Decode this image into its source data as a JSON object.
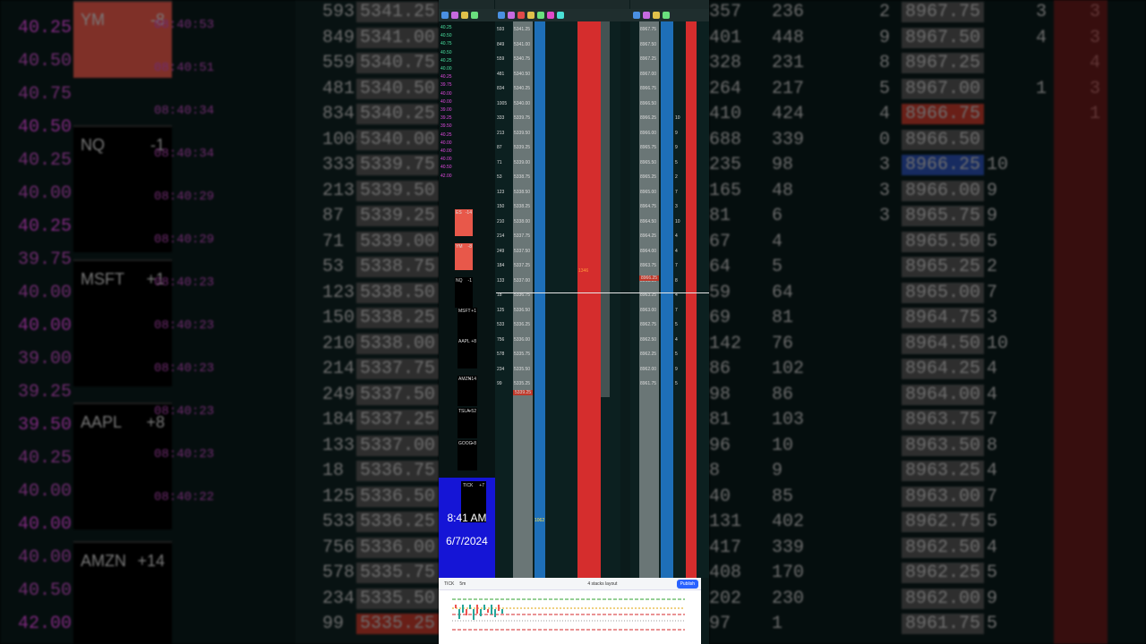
{
  "background_left": {
    "tiles": [
      {
        "symbol": "YM",
        "change": "-8"
      },
      {
        "symbol": "NQ",
        "change": "-1"
      },
      {
        "symbol": "MSFT",
        "change": "+1"
      },
      {
        "symbol": "AAPL",
        "change": "+8"
      },
      {
        "symbol": "AMZN",
        "change": "+14"
      }
    ],
    "ts_prices": [
      "40.25",
      "40.50",
      "40.75",
      "40.50",
      "40.25",
      "40.00",
      "40.25",
      "39.75",
      "40.00",
      "40.00",
      "39.00",
      "39.25",
      "39.50",
      "40.25",
      "40.00",
      "40.00",
      "40.00",
      "40.50",
      "42.00"
    ],
    "ts_times": [
      "08:40:53",
      "08:40:51",
      "08:40:34",
      "08:40:34",
      "08:40:29",
      "08:40:29",
      "08:40:23",
      "08:40:23",
      "08:40:23",
      "08:40:23",
      "08:40:23",
      "08:40:22"
    ],
    "dom_qty": [
      "593",
      "849",
      "559",
      "481",
      "834",
      "1005",
      "333",
      "213",
      "87",
      "71",
      "53",
      "123",
      "150",
      "210",
      "214",
      "249",
      "184",
      "133",
      "18",
      "125",
      "533",
      "756",
      "578",
      "234",
      "99"
    ],
    "dom_price": [
      "5341.25",
      "5341.00",
      "5340.75",
      "5340.50",
      "5340.25",
      "5340.00",
      "5339.75",
      "5339.50",
      "5339.25",
      "5339.00",
      "5338.75",
      "5338.50",
      "5338.25",
      "5338.00",
      "5337.75",
      "5337.50",
      "5337.25",
      "5337.00",
      "5336.75",
      "5336.50",
      "5336.25",
      "5336.00",
      "5335.75",
      "5335.50",
      "5335.25"
    ]
  },
  "background_right": {
    "qty": [
      "357",
      "401",
      "328",
      "264",
      "410",
      "688",
      "235",
      "165",
      "81",
      "67",
      "64",
      "59",
      "69",
      "142",
      "86",
      "98",
      "81",
      "96",
      "8",
      "40",
      "131",
      "417",
      "408",
      "202",
      "97"
    ],
    "vol": [
      "236",
      "448",
      "231",
      "217",
      "424",
      "339",
      "98",
      "48",
      "6",
      "4",
      "5",
      "64",
      "81",
      "76",
      "102",
      "86",
      "103",
      "10",
      "9",
      "85",
      "402",
      "339",
      "170",
      "230",
      "1"
    ],
    "side": [
      "2",
      "9",
      "8",
      "5",
      "4",
      "0",
      "3",
      "3",
      "3",
      "",
      "",
      "",
      "",
      "",
      "",
      "",
      "",
      "",
      "",
      "",
      "",
      "",
      "",
      "",
      ""
    ],
    "price": [
      "8967.75",
      "8967.50",
      "8967.25",
      "8967.00",
      "8966.75",
      "8966.50",
      "8966.25",
      "8966.00",
      "8965.75",
      "8965.50",
      "8965.25",
      "8965.00",
      "8964.75",
      "8964.50",
      "8964.25",
      "8964.00",
      "8963.75",
      "8963.50",
      "8963.25",
      "8963.00",
      "8962.75",
      "8962.50",
      "8962.25",
      "8962.00",
      "8961.75"
    ],
    "bid": [
      "",
      "",
      "",
      "",
      "",
      "",
      "10",
      "9",
      "9",
      "5",
      "2",
      "7",
      "3",
      "10",
      "4",
      "4",
      "7",
      "8",
      "4",
      "7",
      "5",
      "4",
      "5",
      "9",
      "5"
    ],
    "ask": [
      "3",
      "4",
      "",
      "1",
      "",
      "",
      "",
      "",
      "",
      "",
      "",
      "",
      "",
      "",
      "",
      "",
      "",
      "",
      "",
      "",
      "",
      "",
      "",
      "",
      ""
    ],
    "red": [
      "3",
      "3",
      "4",
      "3",
      "1",
      "",
      "",
      "",
      "",
      "",
      "",
      "",
      "",
      "",
      "",
      "",
      "",
      "",
      "",
      "",
      "",
      "",
      "",
      "",
      ""
    ]
  },
  "panel": {
    "clock_time": "8:41 AM",
    "clock_date": "6/7/2024",
    "tick_label": "TICK",
    "tick_value": "+7",
    "mini_tiles": [
      {
        "symbol": "ES",
        "change": "-14"
      },
      {
        "symbol": "YM",
        "change": "-8"
      },
      {
        "symbol": "NQ",
        "change": "-1"
      },
      {
        "symbol": "MSFT",
        "change": "+1"
      },
      {
        "symbol": "AAPL",
        "change": "+8"
      },
      {
        "symbol": "AMZN",
        "change": "+14"
      },
      {
        "symbol": "TSLA",
        "change": "+52"
      },
      {
        "symbol": "GOOG",
        "change": "+8"
      }
    ],
    "last_price_1": "5339.25",
    "last_price_2": "8966.25",
    "big_1": "1346",
    "big_2": "1062"
  },
  "chart": {
    "symbol": "TICK",
    "interval": "5m",
    "layout": "4 stacks layout",
    "publish": "Publish"
  },
  "colors": {
    "bid_blue": "#1e6fb8",
    "ask_red": "#d52d2d",
    "clock_blue": "#1515d6",
    "panel_bg": "#0b1b1b"
  }
}
